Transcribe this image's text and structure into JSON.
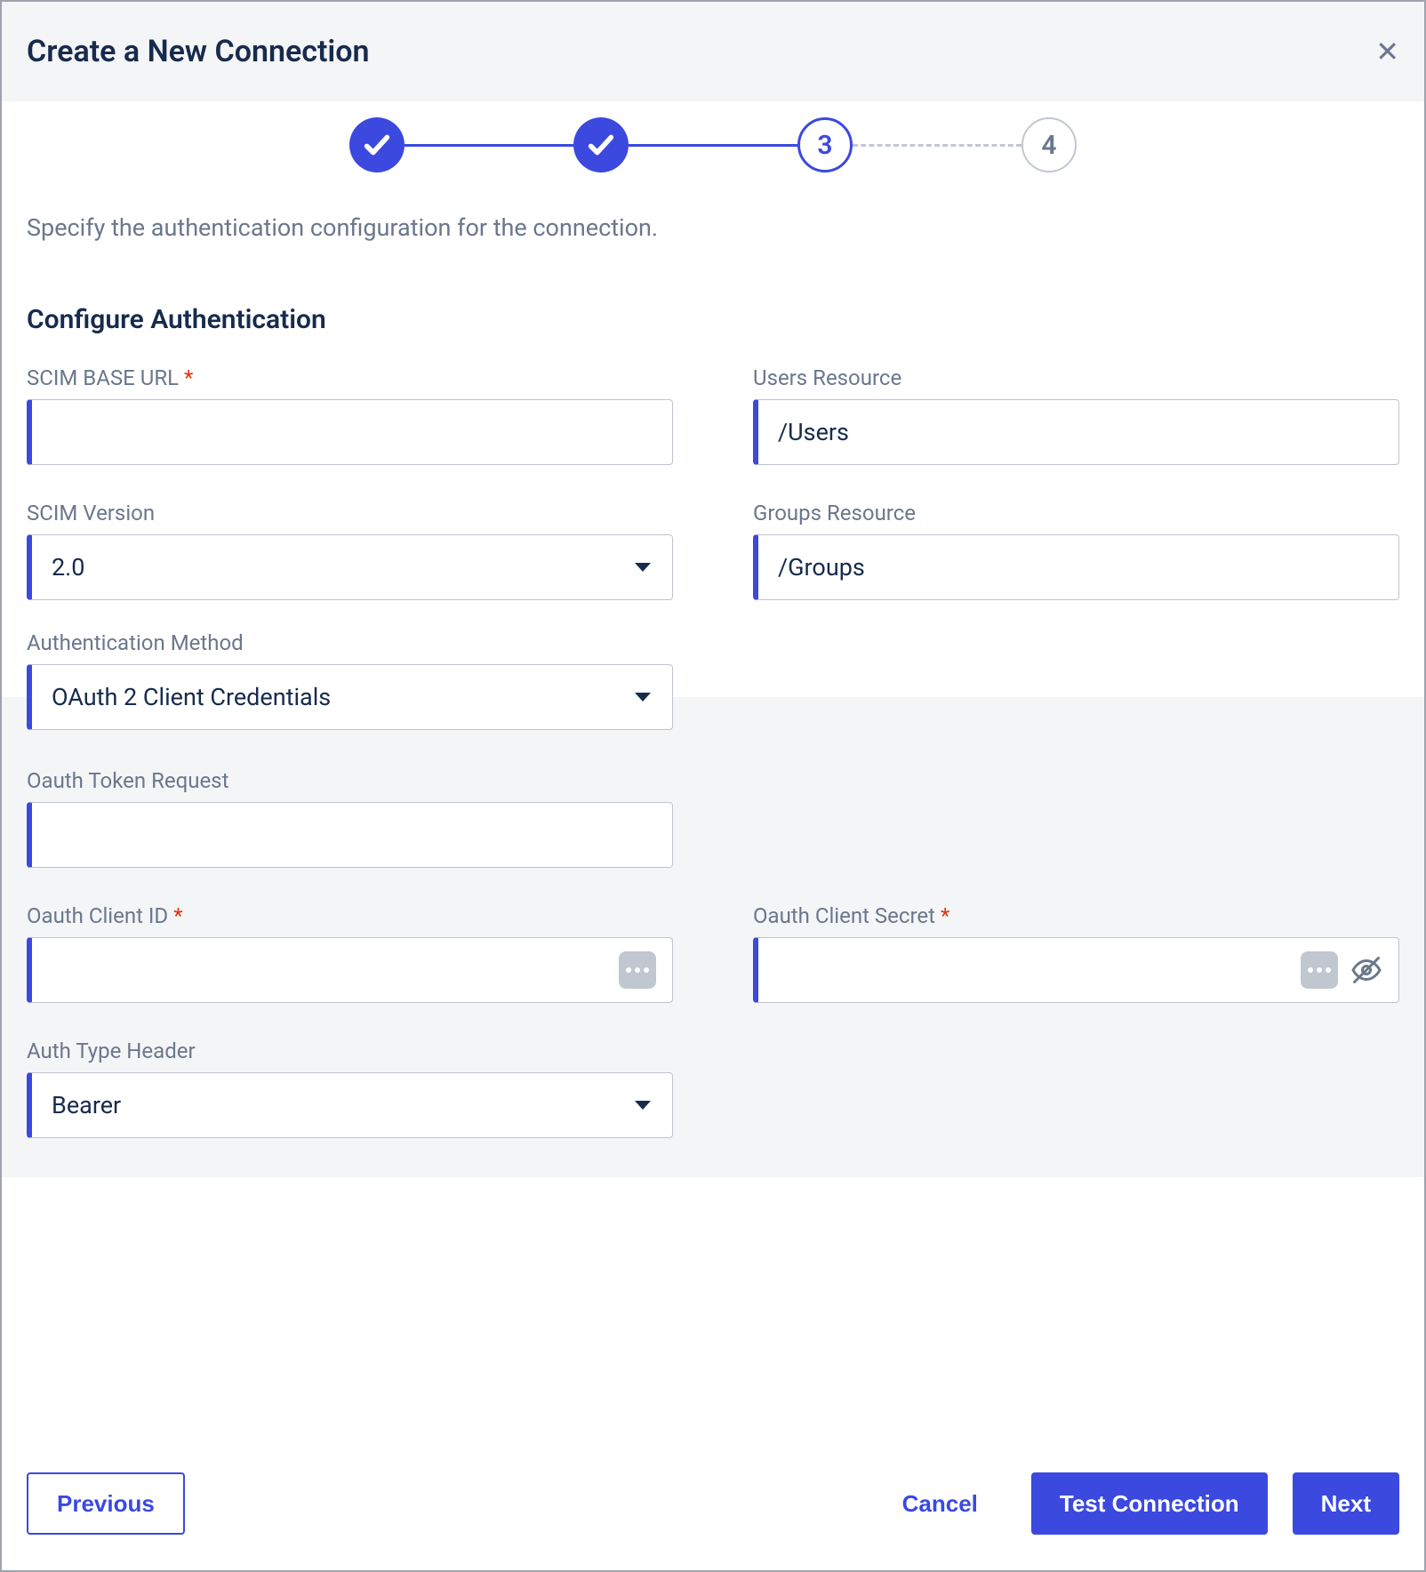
{
  "header": {
    "title": "Create a New Connection"
  },
  "stepper": {
    "active_label": "3",
    "future_label": "4"
  },
  "instruction": "Specify the authentication configuration for the connection.",
  "section_title": "Configure Authentication",
  "fields": {
    "scim_base_url": {
      "label": "SCIM BASE URL",
      "value": ""
    },
    "users_resource": {
      "label": "Users Resource",
      "value": "/Users"
    },
    "scim_version": {
      "label": "SCIM Version",
      "value": "2.0"
    },
    "groups_resource": {
      "label": "Groups Resource",
      "value": "/Groups"
    },
    "auth_method": {
      "label": "Authentication Method",
      "value": "OAuth 2 Client Credentials"
    },
    "oauth_token_request": {
      "label": "Oauth Token Request",
      "value": ""
    },
    "oauth_client_id": {
      "label": "Oauth Client ID",
      "value": ""
    },
    "oauth_client_secret": {
      "label": "Oauth Client Secret",
      "value": ""
    },
    "auth_type_header": {
      "label": "Auth Type Header",
      "value": "Bearer"
    }
  },
  "buttons": {
    "previous": "Previous",
    "cancel": "Cancel",
    "test": "Test Connection",
    "next": "Next"
  },
  "required_mark": "*"
}
